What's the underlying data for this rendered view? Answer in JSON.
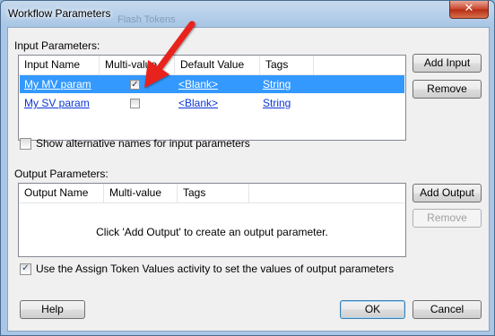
{
  "window": {
    "title": "Workflow Parameters",
    "background_text": "Flash Tokens",
    "close_glyph": "✕"
  },
  "input_params": {
    "label": "Input Parameters:",
    "columns": [
      "Input Name",
      "Multi-value",
      "Default Value",
      "Tags"
    ],
    "rows": [
      {
        "name": "My MV param",
        "multi_value": true,
        "default": "<Blank>",
        "tags": "String",
        "selected": true
      },
      {
        "name": "My SV param",
        "multi_value": false,
        "default": "<Blank>",
        "tags": "String",
        "selected": false
      }
    ],
    "add_label": "Add Input",
    "remove_label": "Remove"
  },
  "show_alt_names": {
    "label": "Show alternative names for input parameters",
    "checked": false
  },
  "output_params": {
    "label": "Output Parameters:",
    "columns": [
      "Output Name",
      "Multi-value",
      "Tags"
    ],
    "empty_message": "Click 'Add Output' to create an output parameter.",
    "add_label": "Add Output",
    "remove_label": "Remove"
  },
  "assign_token": {
    "label": "Use the Assign Token Values activity to set the values of output parameters",
    "checked": true
  },
  "footer": {
    "help_label": "Help",
    "ok_label": "OK",
    "cancel_label": "Cancel"
  },
  "check_glyph": "✓",
  "colors": {
    "selection": "#3399ff",
    "link": "#0b35d6",
    "annotation_arrow": "#e8201c"
  }
}
